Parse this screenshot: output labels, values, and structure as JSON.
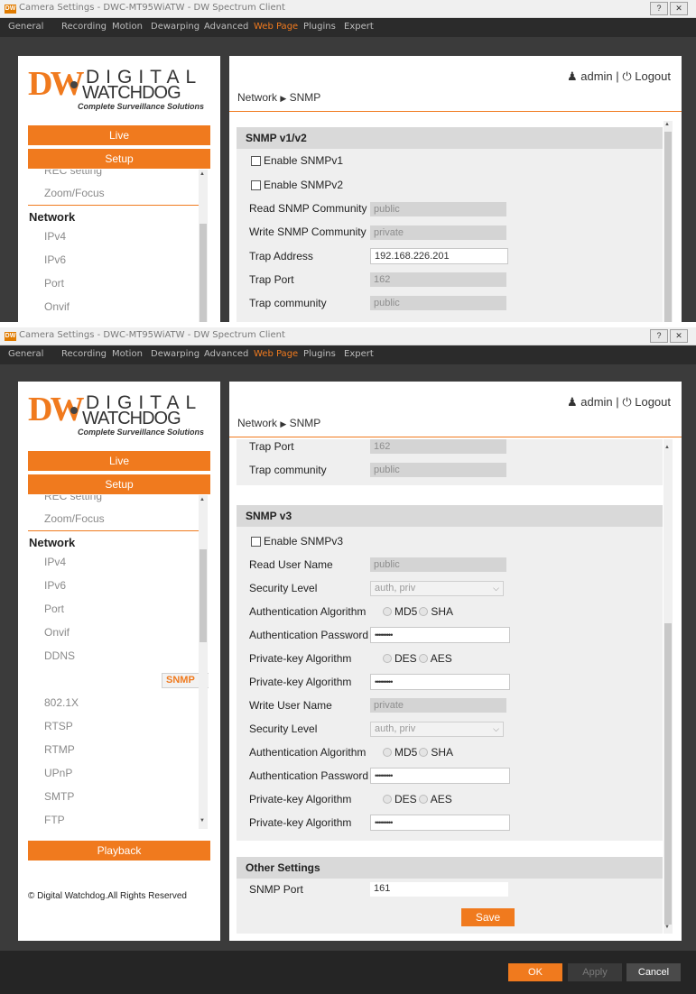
{
  "window_title": "Camera Settings - DWC-MT95WiATW - DW Spectrum Client",
  "logo_text": "DW",
  "help_btn": "?",
  "close_btn": "✕",
  "tabs": [
    "General",
    "Recording",
    "Motion",
    "Dewarping",
    "Advanced",
    "Web Page",
    "Plugins",
    "Expert"
  ],
  "active_tab": "Web Page",
  "brand": {
    "mark": "DW",
    "digital": "DIGITAL",
    "watchdog": "WATCHDOG",
    "tagline": "Complete Surveillance Solutions"
  },
  "left": {
    "live": "Live",
    "setup": "Setup",
    "partial_item": "REC setting",
    "zoom": "Zoom/Focus",
    "network_head": "Network",
    "nav_items": [
      "IPv4",
      "IPv6",
      "Port",
      "Onvif",
      "DDNS",
      "SNMP",
      "802.1X",
      "RTSP",
      "RTMP",
      "UPnP",
      "SMTP",
      "FTP"
    ],
    "selected": "SNMP",
    "playback": "Playback",
    "copyright": "© Digital Watchdog.All Rights Reserved"
  },
  "header": {
    "user": "admin",
    "separator": "|",
    "logout": "Logout",
    "breadcrumb_root": "Network",
    "breadcrumb_arrow": "▶",
    "breadcrumb_page": "SNMP"
  },
  "v12": {
    "title": "SNMP v1/v2",
    "enable_v1": "Enable SNMPv1",
    "enable_v2": "Enable SNMPv2",
    "read_comm_label": "Read SNMP Community",
    "read_comm_value": "public",
    "write_comm_label": "Write SNMP Community",
    "write_comm_value": "private",
    "trap_addr_label": "Trap Address",
    "trap_addr_value": "192.168.226.201",
    "trap_port_label": "Trap Port",
    "trap_port_value": "162",
    "trap_comm_label": "Trap community",
    "trap_comm_value": "public"
  },
  "v3": {
    "title": "SNMP v3",
    "enable_v3": "Enable SNMPv3",
    "read_user_label": "Read User Name",
    "read_user_value": "public",
    "sec_level_label": "Security Level",
    "sec_level_value": "auth, priv",
    "auth_algo_label": "Authentication Algorithm",
    "md5": "MD5",
    "sha": "SHA",
    "auth_pw_label": "Authentication Password",
    "pw_mask": "•••••••••",
    "priv_algo_label": "Private-key Algorithm",
    "des": "DES",
    "aes": "AES",
    "write_user_label": "Write User Name",
    "write_user_value": "private"
  },
  "other": {
    "title": "Other Settings",
    "port_label": "SNMP Port",
    "port_value": "161",
    "save": "Save"
  },
  "footer": {
    "ok": "OK",
    "apply": "Apply",
    "cancel": "Cancel"
  }
}
